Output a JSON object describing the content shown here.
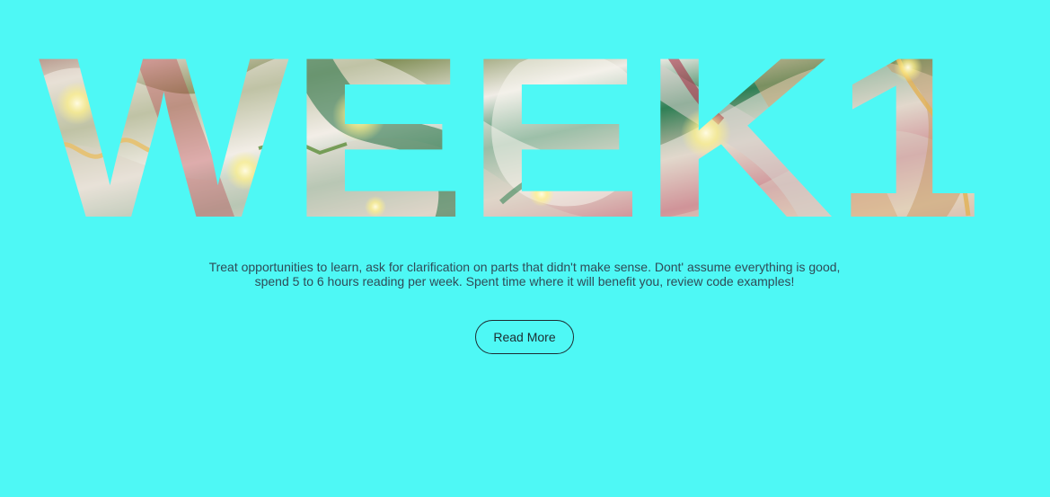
{
  "hero": {
    "title": "WEEK1",
    "title_fill": "festive christmas ornament photo",
    "description": "Treat opportunities to learn, ask for clarification on parts that didn't make sense. Dont' assume everything is good, spend 5 to 6 hours reading per week. Spent time where it will benefit you, review code examples!",
    "read_more_label": "Read More"
  },
  "colors": {
    "background": "#4ef8f5",
    "text": "#2f4b57",
    "button_border": "#1d2c31"
  },
  "icons": []
}
